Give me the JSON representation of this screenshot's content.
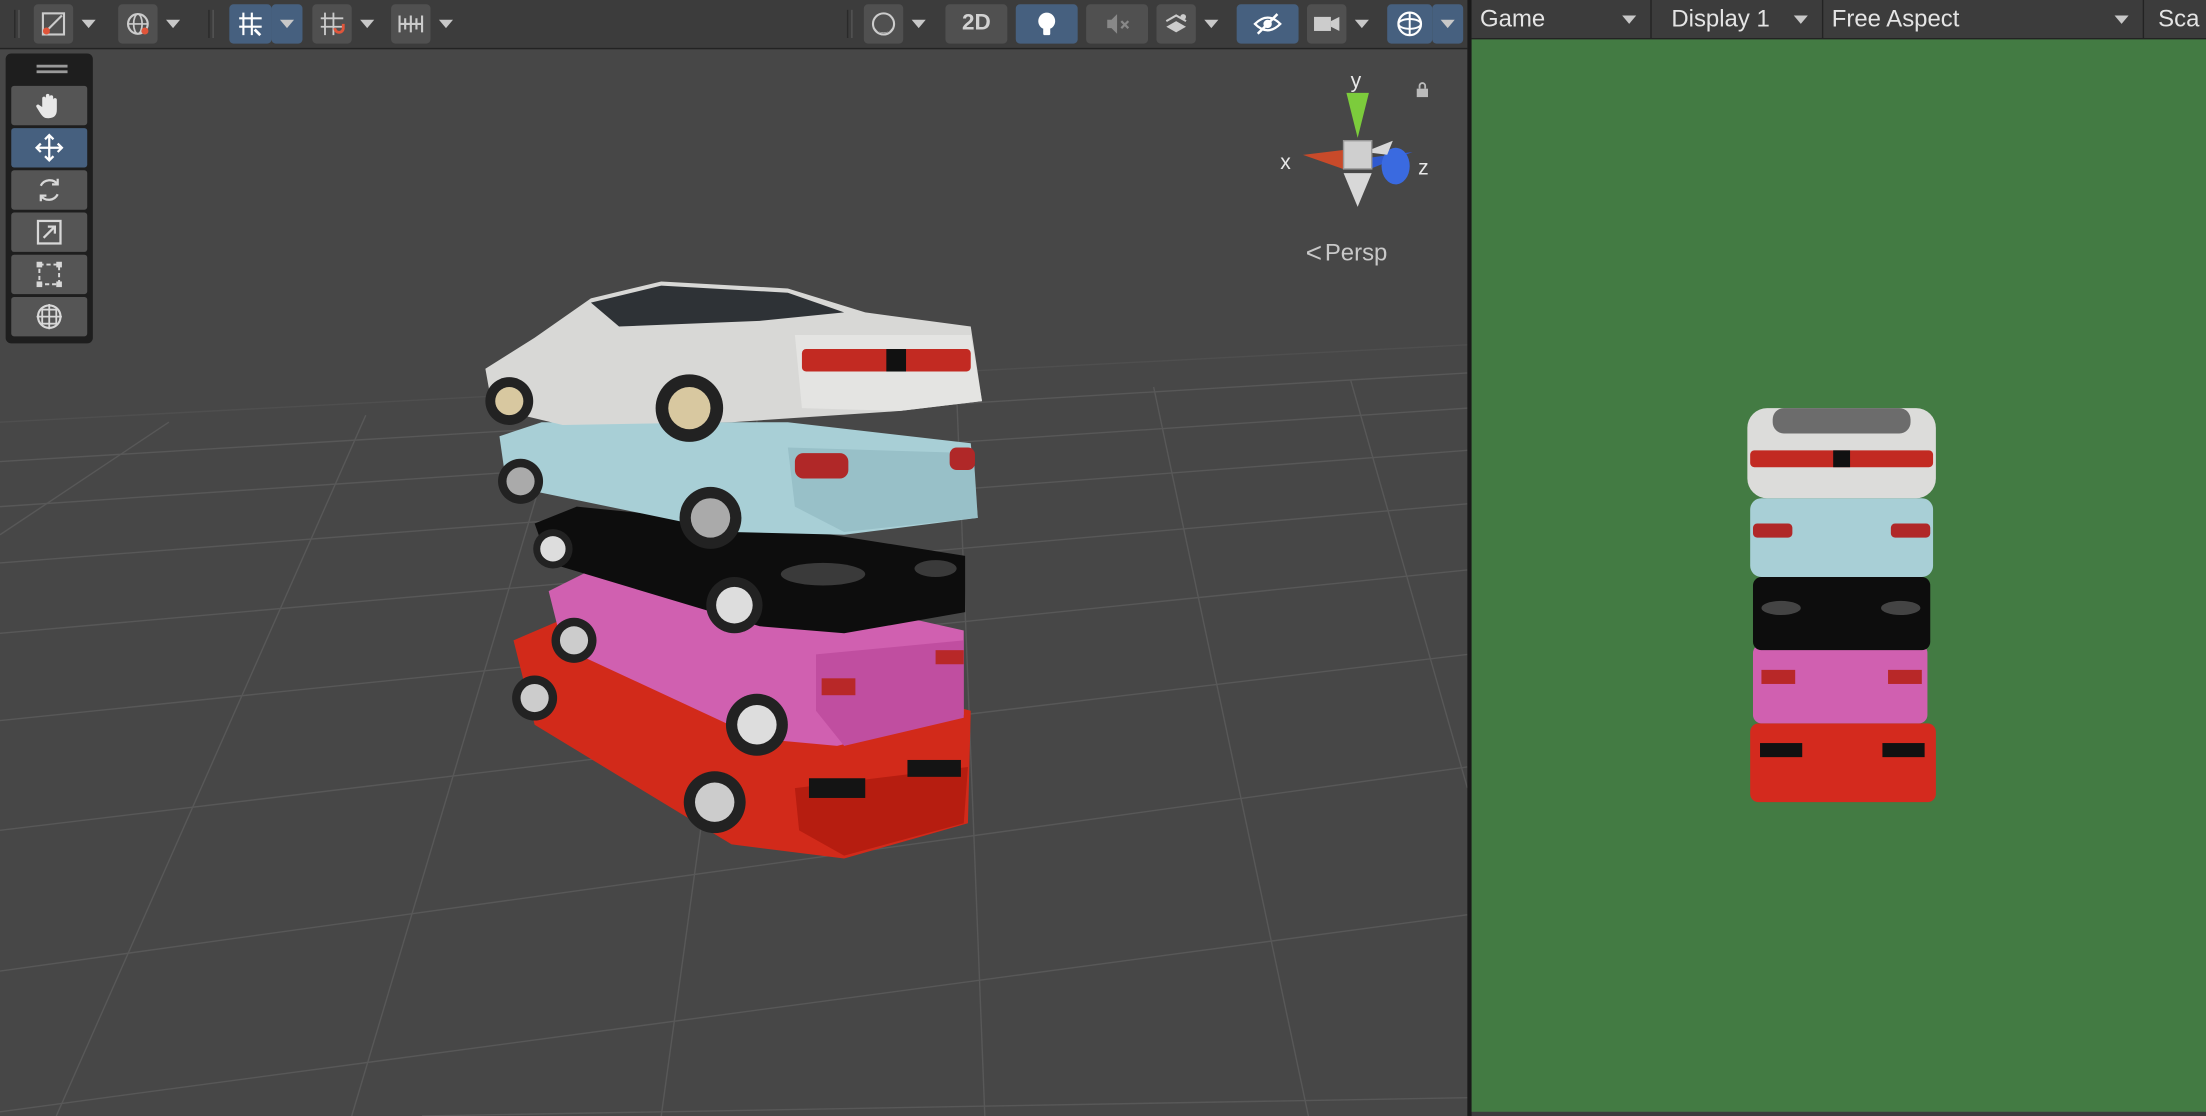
{
  "scene": {
    "toolbar": {
      "btn_2d_label": "2D",
      "icons": [
        "scene-view-icon",
        "global-icon",
        "grid-snap-icon",
        "increment-snap-icon",
        "ruler-icon",
        "draw-mode-icon",
        "lighting-icon",
        "audio-mute-icon",
        "effects-icon",
        "visibility-icon",
        "camera-icon",
        "gizmos-icon"
      ]
    },
    "tools": [
      "hand-icon",
      "move-icon",
      "rotate-icon",
      "scale-icon",
      "rect-icon",
      "transform-icon"
    ],
    "active_tool": "move",
    "gizmo": {
      "x_label": "x",
      "y_label": "y",
      "z_label": "z"
    },
    "projection_label": "Persp",
    "cars": [
      "white-sports-car",
      "light-blue-sedan",
      "black-sedan",
      "pink-hatchback",
      "red-sedan"
    ]
  },
  "game": {
    "tab_label": "Game",
    "display_label": "Display 1",
    "aspect_label": "Free Aspect",
    "scale_label": "Sca",
    "background_color": "#437b43"
  }
}
